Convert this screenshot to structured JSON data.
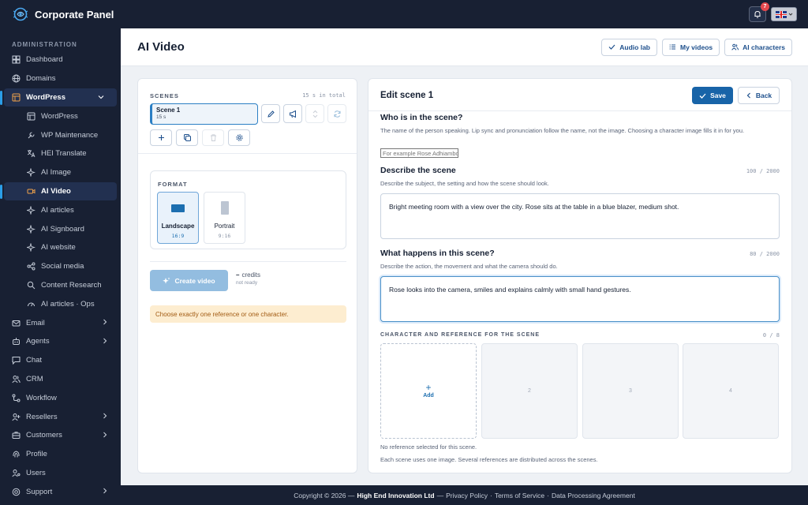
{
  "app": {
    "title": "Corporate Panel"
  },
  "topbar": {
    "notification_count": "7"
  },
  "sidebar": {
    "section": "ADMINISTRATION",
    "items": [
      {
        "label": "Dashboard"
      },
      {
        "label": "Domains"
      },
      {
        "label": "WordPress"
      },
      {
        "label": "WordPress"
      },
      {
        "label": "WP Maintenance"
      },
      {
        "label": "HEI Translate"
      },
      {
        "label": "AI Image"
      },
      {
        "label": "AI Video"
      },
      {
        "label": "AI articles"
      },
      {
        "label": "AI Signboard"
      },
      {
        "label": "AI website"
      },
      {
        "label": "Social media"
      },
      {
        "label": "Content Research"
      },
      {
        "label": "AI articles · Ops"
      },
      {
        "label": "Email"
      },
      {
        "label": "Agents"
      },
      {
        "label": "Chat"
      },
      {
        "label": "CRM"
      },
      {
        "label": "Workflow"
      },
      {
        "label": "Resellers"
      },
      {
        "label": "Customers"
      },
      {
        "label": "Profile"
      },
      {
        "label": "Users"
      },
      {
        "label": "Support"
      }
    ]
  },
  "header": {
    "title": "AI Video",
    "buttons": {
      "audio_lab": "Audio lab",
      "my_videos": "My videos",
      "ai_characters": "AI characters"
    }
  },
  "scenes": {
    "label": "SCENES",
    "total": "15 s in total",
    "list": [
      {
        "name": "Scene 1",
        "duration": "15 s"
      }
    ]
  },
  "format": {
    "label": "FORMAT",
    "options": [
      {
        "name": "Landscape",
        "ratio": "16:9",
        "selected": true
      },
      {
        "name": "Portrait",
        "ratio": "9:16",
        "selected": false
      }
    ]
  },
  "create": {
    "label": "Create video",
    "credits_value": "–",
    "credits_label": "credits",
    "status": "not ready",
    "warning": "Choose exactly one reference or one character."
  },
  "editor": {
    "title": "Edit scene 1",
    "save": "Save",
    "back": "Back",
    "who": {
      "title": "Who is in the scene?",
      "desc": "The name of the person speaking. Lip sync and pronunciation follow the name, not the image. Choosing a character image fills it in for you.",
      "placeholder": "For example Rose Adhiambo"
    },
    "describe": {
      "title": "Describe the scene",
      "counter": "100 / 2000",
      "desc": "Describe the subject, the setting and how the scene should look.",
      "value": "Bright meeting room with a view over the city. Rose sits at the table in a blue blazer, medium shot."
    },
    "happens": {
      "title": "What happens in this scene?",
      "counter": "80 / 2000",
      "desc": "Describe the action, the movement and what the camera should do.",
      "value": "Rose looks into the camera, smiles and explains calmly with small hand gestures."
    },
    "refs": {
      "title": "CHARACTER AND REFERENCE FOR THE SCENE",
      "counter": "0 / 8",
      "add_label": "Add",
      "slots": [
        "2",
        "3",
        "4"
      ],
      "note1": "No reference selected for this scene.",
      "note2": "Each scene uses one image. Several references are distributed across the scenes."
    }
  },
  "footer": {
    "copyright": "Copyright © 2026 —",
    "company": "High End Innovation Ltd",
    "sep": "—",
    "privacy": "Privacy Policy",
    "terms": "Terms of Service",
    "dpa": "Data Processing Agreement",
    "dot": "·"
  },
  "colors": {
    "accent": "#1864a8",
    "sidebar_bg": "#182033",
    "warning_bg": "#fdedd0"
  }
}
